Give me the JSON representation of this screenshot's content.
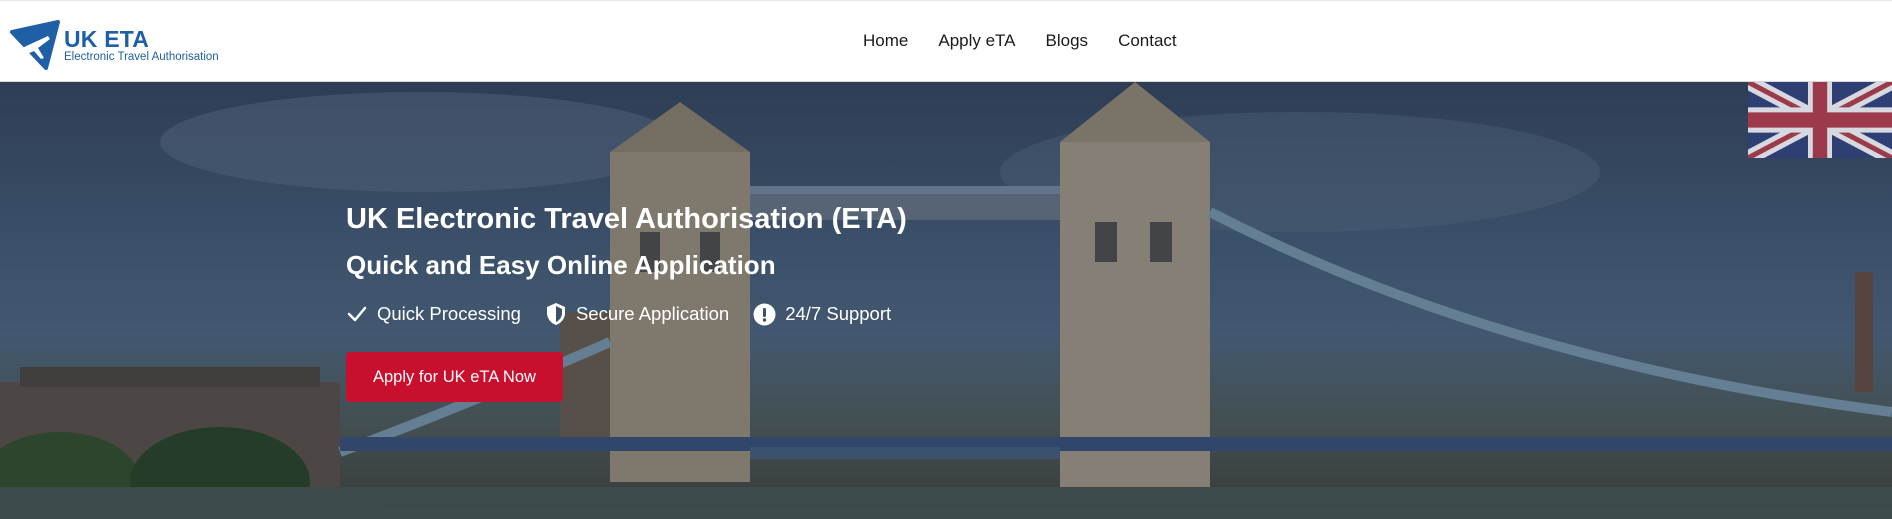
{
  "brand": {
    "name": "UK ETA",
    "tagline": "Electronic Travel Authorisation",
    "color": "#1f5fa5"
  },
  "nav": {
    "items": [
      {
        "label": "Home"
      },
      {
        "label": "Apply eTA"
      },
      {
        "label": "Blogs"
      },
      {
        "label": "Contact"
      }
    ]
  },
  "hero": {
    "title": "UK Electronic Travel Authorisation (ETA)",
    "subtitle": "Quick and Easy Online Application",
    "features": [
      {
        "icon": "check-icon",
        "label": "Quick Processing"
      },
      {
        "icon": "shield-icon",
        "label": "Secure Application"
      },
      {
        "icon": "exclamation-circle-icon",
        "label": "24/7 Support"
      }
    ],
    "cta_label": "Apply for UK eTA Now",
    "cta_color": "#c8102e",
    "background": "tower-bridge-london-photo",
    "flag": "union-jack-flag"
  }
}
